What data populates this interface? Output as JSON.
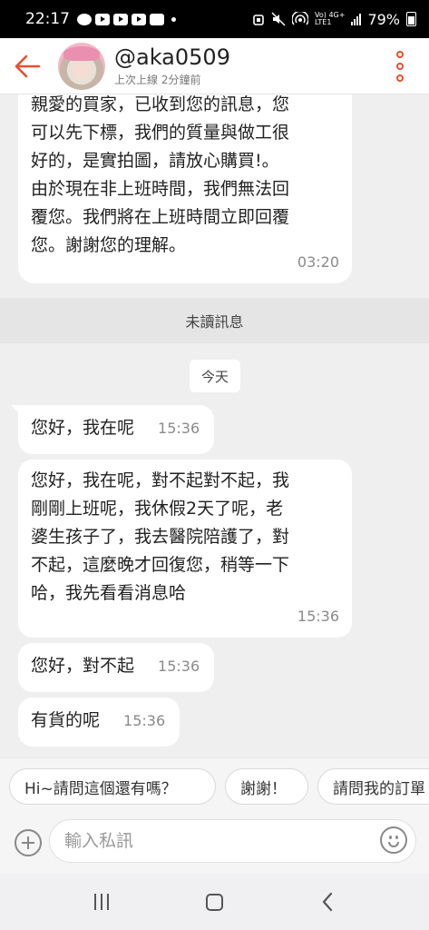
{
  "status_bar": {
    "time": "22:17",
    "network_text_1": "Vo) 4G+",
    "network_text_2": "LTE1",
    "battery": "79%"
  },
  "header": {
    "username": "@aka0509",
    "last_seen": "上次上線 2分鐘前"
  },
  "colors": {
    "accent": "#ee4d2d",
    "background": "#efeff0"
  },
  "messages": [
    {
      "lines": [
        "親愛的買家，已收到您的訊息，您",
        "可以先下標，我們的質量與做工很",
        "好的，是實拍圖，請放心購買!。",
        "由於現在非上班時間，我們無法回",
        "覆您。我們將在上班時間立即回覆",
        "您。謝謝您的理解。"
      ],
      "time": "03:20"
    },
    {
      "text": "您好，我在呢",
      "time": "15:36"
    },
    {
      "lines": [
        "您好，我在呢，對不起對不起，我",
        "剛剛上班呢，我休假2天了呢，老",
        "婆生孩子了，我去醫院陪護了，對",
        "不起，這麼晚才回復您，稍等一下",
        "哈，我先看看消息哈"
      ],
      "time": "15:36"
    },
    {
      "text": "您好，對不起",
      "time": "15:36"
    },
    {
      "text": "有貨的呢",
      "time": "15:36"
    }
  ],
  "unread_divider": "未讀訊息",
  "date_divider": "今天",
  "quick_replies": [
    "Hi~請問這個還有嗎？",
    "謝謝！",
    "請問我的訂單"
  ],
  "composer": {
    "placeholder": "輸入私訊"
  },
  "icons": {
    "back": "back-arrow-icon",
    "more": "more-vertical-icon",
    "add": "add-circle-icon",
    "emoji": "emoji-icon",
    "nav_recent": "recent-apps-icon",
    "nav_home": "home-icon",
    "nav_back": "back-icon"
  }
}
